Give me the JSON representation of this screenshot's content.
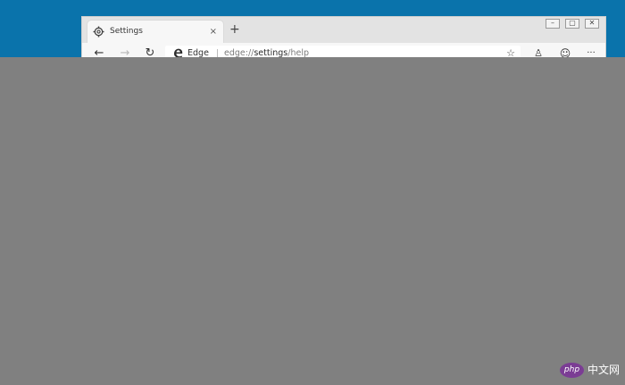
{
  "tab": {
    "title": "Settings",
    "close": "×",
    "icon": "gear-icon"
  },
  "new_tab": "+",
  "window_controls": {
    "minimize": "–",
    "maximize": "▢",
    "close": "✕"
  },
  "nav": {
    "back": "←",
    "forward": "→",
    "refresh": "↻"
  },
  "address": {
    "brand": "Edge",
    "url_prefix": "edge://",
    "url_path": "settings",
    "url_suffix": "/help"
  },
  "toolbar_icons": {
    "favorite": "☆",
    "profile": "♙",
    "emoji": "☺",
    "more": "···"
  },
  "watermark": {
    "logo": "php",
    "text": "中文网"
  },
  "colors": {
    "desktop": "#0a73ab",
    "overlay": "#808080",
    "watermark_logo": "#7b3d94"
  }
}
